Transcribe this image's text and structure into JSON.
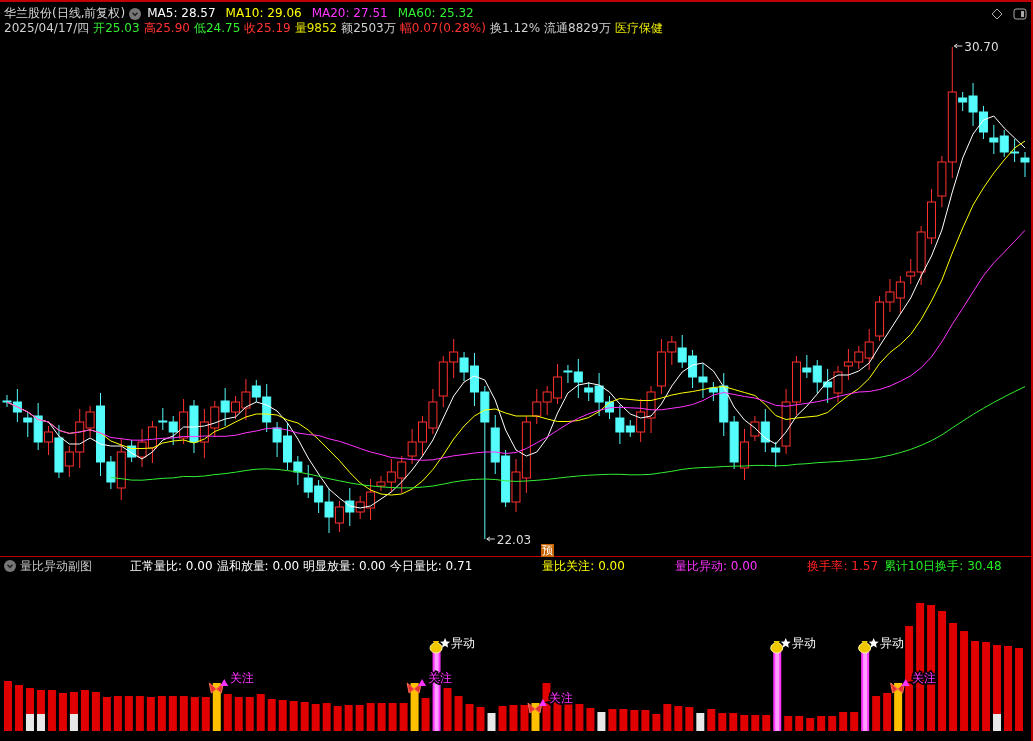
{
  "main_panel": {
    "title": "华兰股份(日线,前复权)",
    "moving_averages": [
      {
        "label": "MA5: 28.57",
        "color": "#ffffff"
      },
      {
        "label": "MA10: 29.06",
        "color": "#ffff00"
      },
      {
        "label": "MA20: 27.51",
        "color": "#ff33ff"
      },
      {
        "label": "MA60: 25.32",
        "color": "#33ee33"
      }
    ],
    "quote_line": [
      {
        "text": "2025/04/17/四",
        "color": "#d0d0d0"
      },
      {
        "text": "开25.03",
        "color": "#33ee33"
      },
      {
        "text": "高25.90",
        "color": "#ff3333"
      },
      {
        "text": "低24.75",
        "color": "#33ee33"
      },
      {
        "text": "收25.19",
        "color": "#ff3333"
      },
      {
        "text": "量9852",
        "color": "#e8e800"
      },
      {
        "text": "额2503万",
        "color": "#d0d0d0"
      },
      {
        "text": "幅0.07(0.28%)",
        "color": "#ff3333"
      },
      {
        "text": "换1.12%",
        "color": "#d0d0d0"
      },
      {
        "text": "流通8829万",
        "color": "#d0d0d0"
      },
      {
        "text": "医疗保健",
        "color": "#e8e800"
      }
    ],
    "high_label": "30.70",
    "low_label": "22.03",
    "forecast_marker": "预"
  },
  "sub_panel": {
    "title": "量比异动副图",
    "stats": [
      {
        "text": "正常量比: 0.00",
        "color": "#ffffff"
      },
      {
        "text": "温和放量: 0.00",
        "color": "#ffffff"
      },
      {
        "text": "明显放量: 0.00",
        "color": "#ffffff"
      },
      {
        "text": "今日量比: 0.71",
        "color": "#ffffff"
      },
      {
        "text": "量比关注: 0.00",
        "color": "#ffff00"
      },
      {
        "text": "量比异动: 0.00",
        "color": "#ff33ff"
      },
      {
        "text": "换手率: 1.57",
        "color": "#ff2222"
      },
      {
        "text": "累计10日换手: 30.48",
        "color": "#22ee22"
      }
    ],
    "signals": [
      {
        "kind": "focus",
        "label": "关注"
      },
      {
        "kind": "focus",
        "label": "关注"
      },
      {
        "kind": "anomaly",
        "label": "异动"
      },
      {
        "kind": "focus",
        "label": "关注"
      },
      {
        "kind": "anomaly",
        "label": "异动"
      },
      {
        "kind": "anomaly",
        "label": "异动"
      },
      {
        "kind": "focus",
        "label": "关注"
      }
    ]
  }
}
